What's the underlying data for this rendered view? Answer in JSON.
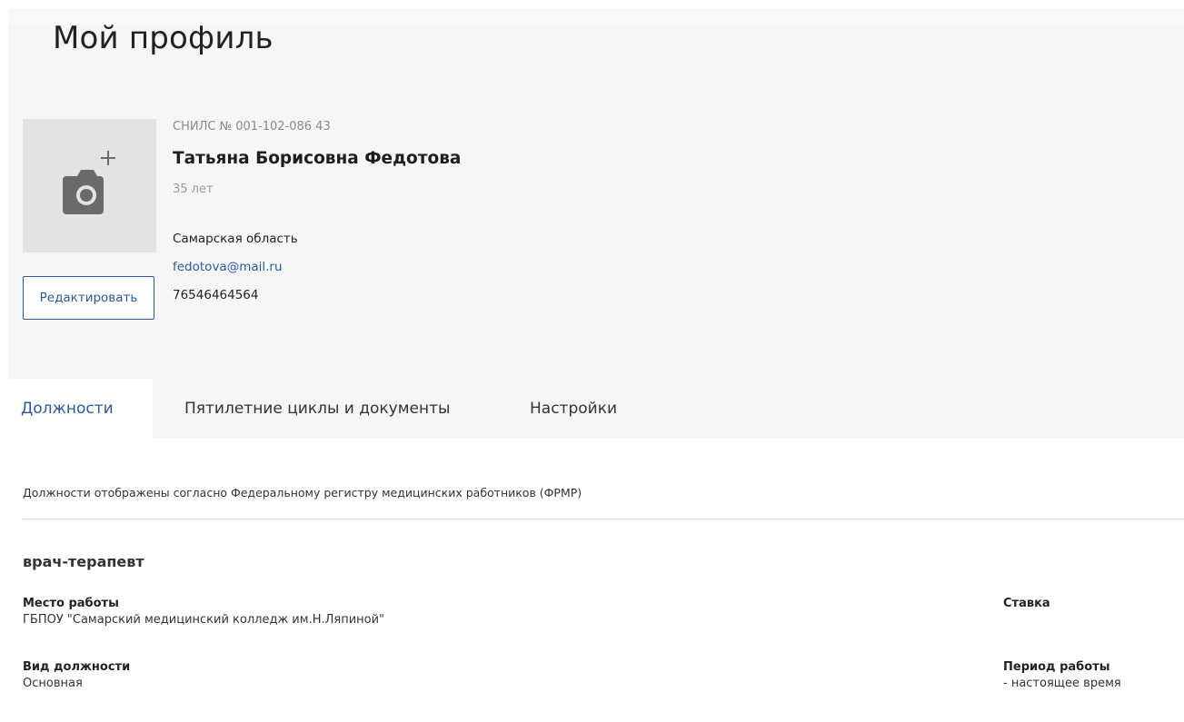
{
  "page": {
    "title": "Мой профиль"
  },
  "profile": {
    "snils": "СНИЛС № 001-102-086 43",
    "full_name": "Татьяна Борисовна Федотова",
    "age": "35 лет",
    "region": "Самарская область",
    "email": "fedotova@mail.ru",
    "phone": "76546464564",
    "edit_label": "Редактировать",
    "photo_icon": "camera-add-icon"
  },
  "tabs": [
    {
      "label": "Должности",
      "active": true
    },
    {
      "label": "Пятилетние циклы и документы",
      "active": false
    },
    {
      "label": "Настройки",
      "active": false
    }
  ],
  "positions": {
    "note": "Должности отображены согласно Федеральному регистру медицинских работников (ФРМР)",
    "item": {
      "title": "врач-терапевт",
      "workplace_label": "Место работы",
      "workplace_value": "ГБПОУ \"Самарский медицинский колледж им.Н.Ляпиной\"",
      "rate_label": "Ставка",
      "type_label": "Вид должности",
      "type_value": "Основная",
      "period_label": "Период работы",
      "period_value": "- настоящее время"
    }
  },
  "colors": {
    "accent": "#2b5aa0",
    "header_bg": "#f6f6f7",
    "photo_bg": "#e3e3e3"
  }
}
